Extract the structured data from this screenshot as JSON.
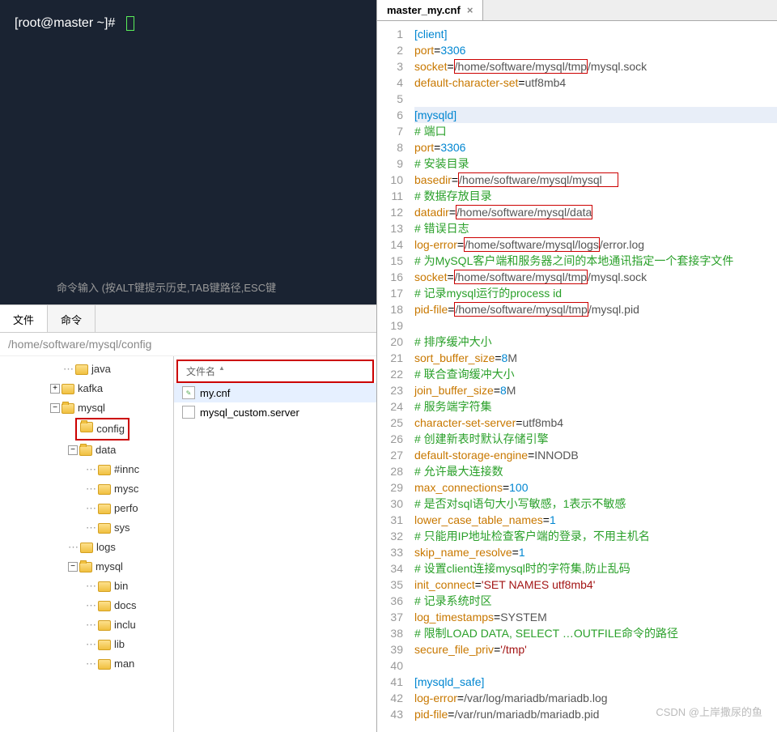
{
  "terminal": {
    "prompt": "[root@master ~]#",
    "hint": "命令输入 (按ALT键提示历史,TAB键路径,ESC键"
  },
  "file_browser": {
    "tabs": {
      "files": "文件",
      "commands": "命令"
    },
    "path": "/home/software/mysql/config",
    "filelist_header": "文件名",
    "files": [
      {
        "name": "my.cnf",
        "selected": true
      },
      {
        "name": "mysql_custom.server",
        "selected": false
      }
    ],
    "tree": {
      "java": "java",
      "kafka": "kafka",
      "mysql": "mysql",
      "config": "config",
      "data": "data",
      "innodb": "#innc",
      "mysc": "mysc",
      "perfo": "perfo",
      "sys": "sys",
      "logs": "logs",
      "mysql2": "mysql",
      "bin": "bin",
      "docs": "docs",
      "inclu": "inclu",
      "lib": "lib",
      "man": "man"
    }
  },
  "editor": {
    "tab_title": "master_my.cnf",
    "lines": [
      {
        "n": 1,
        "parts": [
          {
            "t": "br",
            "v": "["
          },
          {
            "t": "sec",
            "v": "client"
          },
          {
            "t": "br",
            "v": "]"
          }
        ]
      },
      {
        "n": 2,
        "parts": [
          {
            "t": "key",
            "v": "port"
          },
          {
            "t": "eq",
            "v": "="
          },
          {
            "t": "num",
            "v": "3306"
          }
        ]
      },
      {
        "n": 3,
        "parts": [
          {
            "t": "key",
            "v": "socket"
          },
          {
            "t": "eq",
            "v": "="
          },
          {
            "box": true,
            "t": "val",
            "v": "/home/software/mysql/tmp"
          },
          {
            "t": "val",
            "v": "/mysql.sock"
          }
        ]
      },
      {
        "n": 4,
        "parts": [
          {
            "t": "key",
            "v": "default-character-set"
          },
          {
            "t": "eq",
            "v": "="
          },
          {
            "t": "val",
            "v": "utf8mb4"
          }
        ]
      },
      {
        "n": 5,
        "parts": []
      },
      {
        "n": 6,
        "active": true,
        "parts": [
          {
            "t": "br",
            "v": "["
          },
          {
            "t": "sec",
            "v": "mysqld"
          },
          {
            "t": "br",
            "v": "]"
          }
        ]
      },
      {
        "n": 7,
        "parts": [
          {
            "t": "cmt",
            "v": "# 端口"
          }
        ]
      },
      {
        "n": 8,
        "parts": [
          {
            "t": "key",
            "v": "port"
          },
          {
            "t": "eq",
            "v": "="
          },
          {
            "t": "num",
            "v": "3306"
          }
        ]
      },
      {
        "n": 9,
        "parts": [
          {
            "t": "cmt",
            "v": "# 安装目录"
          }
        ]
      },
      {
        "n": 10,
        "parts": [
          {
            "t": "key",
            "v": "basedir"
          },
          {
            "t": "eq",
            "v": "="
          },
          {
            "box": true,
            "t": "val",
            "v": "/home/software/mysql/mysql     "
          }
        ]
      },
      {
        "n": 11,
        "parts": [
          {
            "t": "cmt",
            "v": "# 数据存放目录"
          }
        ]
      },
      {
        "n": 12,
        "parts": [
          {
            "t": "key",
            "v": "datadir"
          },
          {
            "t": "eq",
            "v": "="
          },
          {
            "box": true,
            "t": "val",
            "v": "/home/software/mysql/data"
          }
        ]
      },
      {
        "n": 13,
        "parts": [
          {
            "t": "cmt",
            "v": "# 错误日志"
          }
        ]
      },
      {
        "n": 14,
        "parts": [
          {
            "t": "key",
            "v": "log-error"
          },
          {
            "t": "eq",
            "v": "="
          },
          {
            "box": true,
            "t": "val",
            "v": "/home/software/mysql/logs"
          },
          {
            "t": "val",
            "v": "/error.log"
          }
        ]
      },
      {
        "n": 15,
        "parts": [
          {
            "t": "cmt",
            "v": "# 为MySQL客户端和服务器之间的本地通讯指定一个套接字文件"
          }
        ]
      },
      {
        "n": 16,
        "parts": [
          {
            "t": "key",
            "v": "socket"
          },
          {
            "t": "eq",
            "v": "="
          },
          {
            "box": true,
            "t": "val",
            "v": "/home/software/mysql/tmp"
          },
          {
            "t": "val",
            "v": "/mysql.sock"
          }
        ]
      },
      {
        "n": 17,
        "parts": [
          {
            "t": "cmt",
            "v": "# 记录mysql运行的process id"
          }
        ]
      },
      {
        "n": 18,
        "parts": [
          {
            "t": "key",
            "v": "pid-file"
          },
          {
            "t": "eq",
            "v": "="
          },
          {
            "box": true,
            "t": "val",
            "v": "/home/software/mysql/tmp"
          },
          {
            "t": "val",
            "v": "/mysql.pid"
          }
        ]
      },
      {
        "n": 19,
        "parts": []
      },
      {
        "n": 20,
        "parts": [
          {
            "t": "cmt",
            "v": "# 排序缓冲大小"
          }
        ]
      },
      {
        "n": 21,
        "parts": [
          {
            "t": "key",
            "v": "sort_buffer_size"
          },
          {
            "t": "eq",
            "v": "="
          },
          {
            "t": "num",
            "v": "8"
          },
          {
            "t": "val",
            "v": "M"
          }
        ]
      },
      {
        "n": 22,
        "parts": [
          {
            "t": "cmt",
            "v": "# 联合查询缓冲大小"
          }
        ]
      },
      {
        "n": 23,
        "parts": [
          {
            "t": "key",
            "v": "join_buffer_size"
          },
          {
            "t": "eq",
            "v": "="
          },
          {
            "t": "num",
            "v": "8"
          },
          {
            "t": "val",
            "v": "M"
          }
        ]
      },
      {
        "n": 24,
        "parts": [
          {
            "t": "cmt",
            "v": "# 服务端字符集"
          }
        ]
      },
      {
        "n": 25,
        "parts": [
          {
            "t": "key",
            "v": "character-set-server"
          },
          {
            "t": "eq",
            "v": "="
          },
          {
            "t": "val",
            "v": "utf8mb4"
          }
        ]
      },
      {
        "n": 26,
        "parts": [
          {
            "t": "cmt",
            "v": "# 创建新表时默认存储引擎"
          }
        ]
      },
      {
        "n": 27,
        "parts": [
          {
            "t": "key",
            "v": "default-storage-engine"
          },
          {
            "t": "eq",
            "v": "="
          },
          {
            "t": "val",
            "v": "INNODB"
          }
        ]
      },
      {
        "n": 28,
        "parts": [
          {
            "t": "cmt",
            "v": "# 允许最大连接数"
          }
        ]
      },
      {
        "n": 29,
        "parts": [
          {
            "t": "key",
            "v": "max_connections"
          },
          {
            "t": "eq",
            "v": "="
          },
          {
            "t": "num",
            "v": "100"
          }
        ]
      },
      {
        "n": 30,
        "parts": [
          {
            "t": "cmt",
            "v": "# 是否对sql语句大小写敏感，1表示不敏感"
          }
        ]
      },
      {
        "n": 31,
        "parts": [
          {
            "t": "key",
            "v": "lower_case_table_names"
          },
          {
            "t": "eq",
            "v": "="
          },
          {
            "t": "num",
            "v": "1"
          }
        ]
      },
      {
        "n": 32,
        "parts": [
          {
            "t": "cmt",
            "v": "# 只能用IP地址检查客户端的登录，不用主机名"
          }
        ]
      },
      {
        "n": 33,
        "parts": [
          {
            "t": "key",
            "v": "skip_name_resolve"
          },
          {
            "t": "eq",
            "v": "="
          },
          {
            "t": "num",
            "v": "1"
          }
        ]
      },
      {
        "n": 34,
        "parts": [
          {
            "t": "cmt",
            "v": "# 设置client连接mysql时的字符集,防止乱码"
          }
        ]
      },
      {
        "n": 35,
        "parts": [
          {
            "t": "key",
            "v": "init_connect"
          },
          {
            "t": "eq",
            "v": "="
          },
          {
            "t": "str",
            "v": "'SET NAMES utf8mb4'"
          }
        ]
      },
      {
        "n": 36,
        "parts": [
          {
            "t": "cmt",
            "v": "# 记录系统时区"
          }
        ]
      },
      {
        "n": 37,
        "parts": [
          {
            "t": "key",
            "v": "log_timestamps"
          },
          {
            "t": "eq",
            "v": "="
          },
          {
            "t": "val",
            "v": "SYSTEM"
          }
        ]
      },
      {
        "n": 38,
        "parts": [
          {
            "t": "cmt",
            "v": "# 限制LOAD DATA, SELECT …OUTFILE命令的路径"
          }
        ]
      },
      {
        "n": 39,
        "parts": [
          {
            "t": "key",
            "v": "secure_file_priv"
          },
          {
            "t": "eq",
            "v": "="
          },
          {
            "t": "str",
            "v": "'/tmp'"
          }
        ]
      },
      {
        "n": 40,
        "parts": []
      },
      {
        "n": 41,
        "parts": [
          {
            "t": "br",
            "v": "["
          },
          {
            "t": "sec",
            "v": "mysqld_safe"
          },
          {
            "t": "br",
            "v": "]"
          }
        ]
      },
      {
        "n": 42,
        "parts": [
          {
            "t": "key",
            "v": "log-error"
          },
          {
            "t": "eq",
            "v": "="
          },
          {
            "t": "val",
            "v": "/var/log/mariadb/mariadb.log"
          }
        ]
      },
      {
        "n": 43,
        "parts": [
          {
            "t": "key",
            "v": "pid-file"
          },
          {
            "t": "eq",
            "v": "="
          },
          {
            "t": "val",
            "v": "/var/run/mariadb/mariadb.pid"
          }
        ]
      }
    ]
  },
  "watermark": "CSDN @上岸撒尿的鱼"
}
